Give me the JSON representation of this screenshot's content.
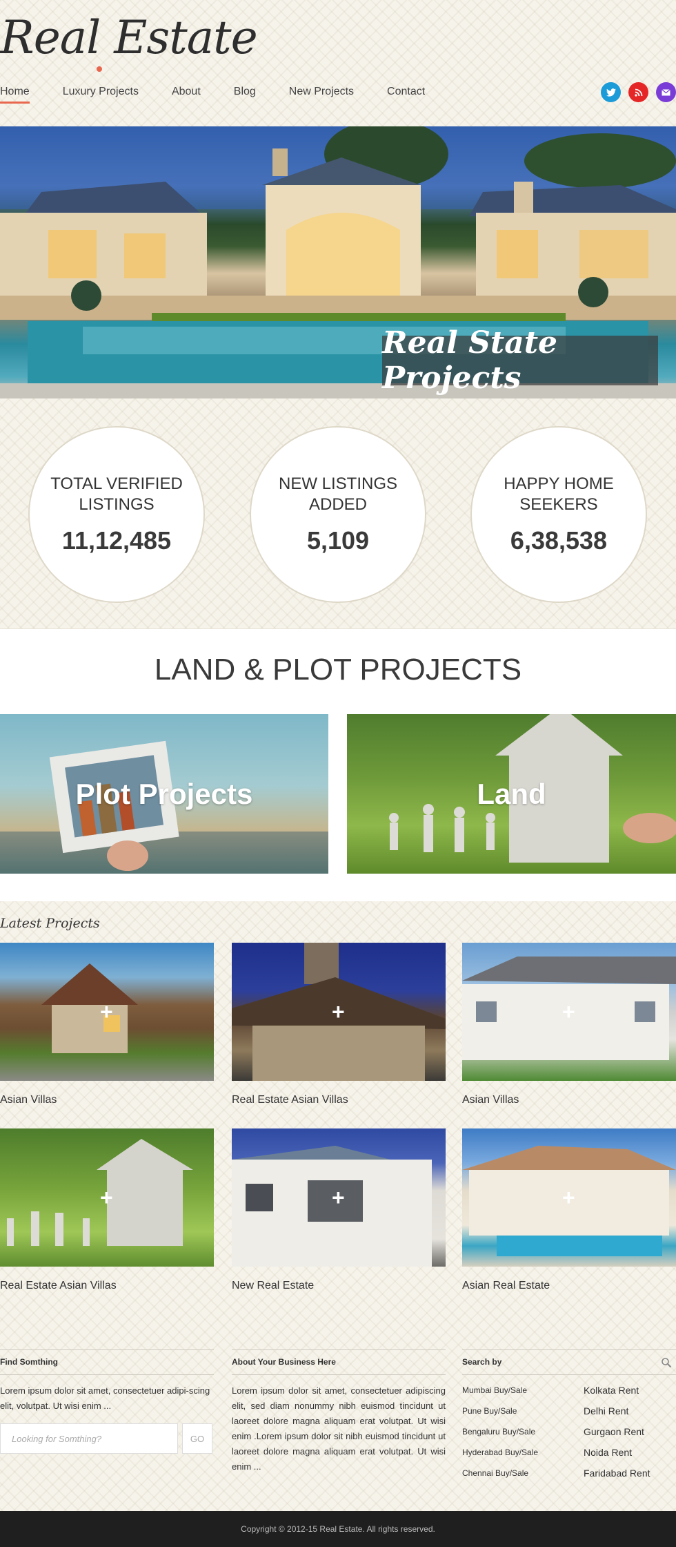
{
  "header": {
    "logo": "Real Estate",
    "nav": [
      "Home",
      "Luxury Projects",
      "About",
      "Blog",
      "New Projects",
      "Contact"
    ],
    "social": [
      {
        "icon": "twitter-icon",
        "color": "#1b9bd8"
      },
      {
        "icon": "rss-icon",
        "color": "#e52626"
      },
      {
        "icon": "email-icon",
        "color": "#7a3cd6"
      }
    ]
  },
  "hero": {
    "caption": "Real State Projects"
  },
  "stats": [
    {
      "label": "TOTAL VERIFIED LISTINGS",
      "value": "11,12,485"
    },
    {
      "label": "NEW LISTINGS ADDED",
      "value": "5,109"
    },
    {
      "label": "HAPPY HOME SEEKERS",
      "value": "6,38,538"
    }
  ],
  "land": {
    "title": "LAND & PLOT PROJECTS",
    "cards": [
      "Plot Projects",
      "Land"
    ]
  },
  "latest": {
    "title": "Latest Projects",
    "items": [
      "Asian Villas",
      "Real Estate  Asian Villas",
      "Asian Villas",
      "Real Estate Asian Villas",
      "New Real Estate",
      "Asian Real Estate"
    ],
    "plus": "+"
  },
  "footer": {
    "find": {
      "title": "Find Somthing",
      "text": "Lorem ipsum dolor sit amet, consectetuer adipi-scing elit, volutpat. Ut wisi enim ...",
      "placeholder": "Looking for Somthing?",
      "button": "GO"
    },
    "about": {
      "title": "About Your Business Here",
      "text": "Lorem ipsum dolor sit amet, consectetuer adipiscing elit, sed diam nonummy nibh euismod tincidunt ut laoreet dolore magna aliquam erat volutpat. Ut wisi enim .Lorem ipsum dolor sit  nibh euismod tincidunt ut laoreet dolore magna aliquam erat volutpat. Ut wisi enim ..."
    },
    "search": {
      "title": "Search by",
      "left": [
        "Mumbai Buy/Sale",
        "Pune Buy/Sale",
        "Bengaluru Buy/Sale",
        "Hyderabad Buy/Sale",
        "Chennai Buy/Sale"
      ],
      "right": [
        "Kolkata Rent",
        "Delhi Rent",
        "Gurgaon Rent",
        "Noida Rent",
        "Faridabad Rent"
      ]
    },
    "copyright": "Copyright © 2012-15 Real Estate. All rights reserved."
  }
}
